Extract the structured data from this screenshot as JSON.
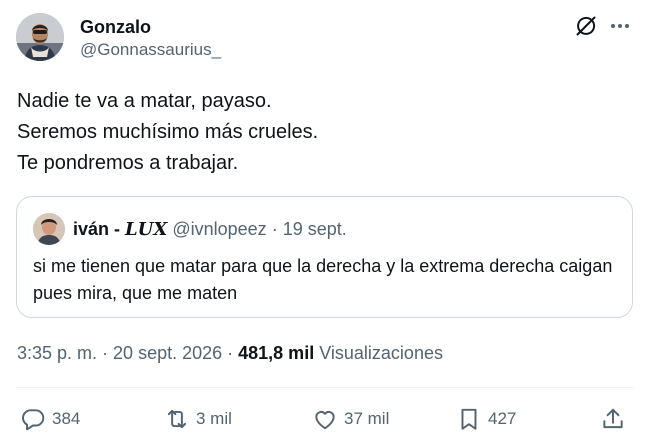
{
  "tweet": {
    "author": {
      "display_name": "Gonzalo",
      "handle": "@Gonnassaurius_"
    },
    "text_lines": [
      "Nadie te va a matar, payaso.",
      "Seremos muchísimo más crueles.",
      "Te pondremos a trabajar."
    ],
    "quoted": {
      "name": "iván - ",
      "name_styled": "𝑳𝑼𝑿",
      "handle": "@ivnlopeez",
      "separator": " · ",
      "date": "19 sept.",
      "text": "si me tienen que matar para que la derecha y la extrema derecha caigan pues mira, que me maten"
    },
    "meta": {
      "time": "3:35 p. m.",
      "separator": " · ",
      "date": "20 sept. 2026",
      "views_count": "481,8 mil",
      "views_label": "Visualizaciones"
    },
    "actions": {
      "replies": "384",
      "reposts": "3 mil",
      "likes": "37 mil",
      "bookmarks": "427"
    }
  },
  "icons": {
    "grok": "grok-icon",
    "more": "more-icon",
    "reply": "reply-icon",
    "repost": "repost-icon",
    "like": "heart-icon",
    "bookmark": "bookmark-icon",
    "share": "share-icon"
  },
  "colors": {
    "text": "#0f1419",
    "secondary": "#536471",
    "border": "#cfd9de"
  }
}
